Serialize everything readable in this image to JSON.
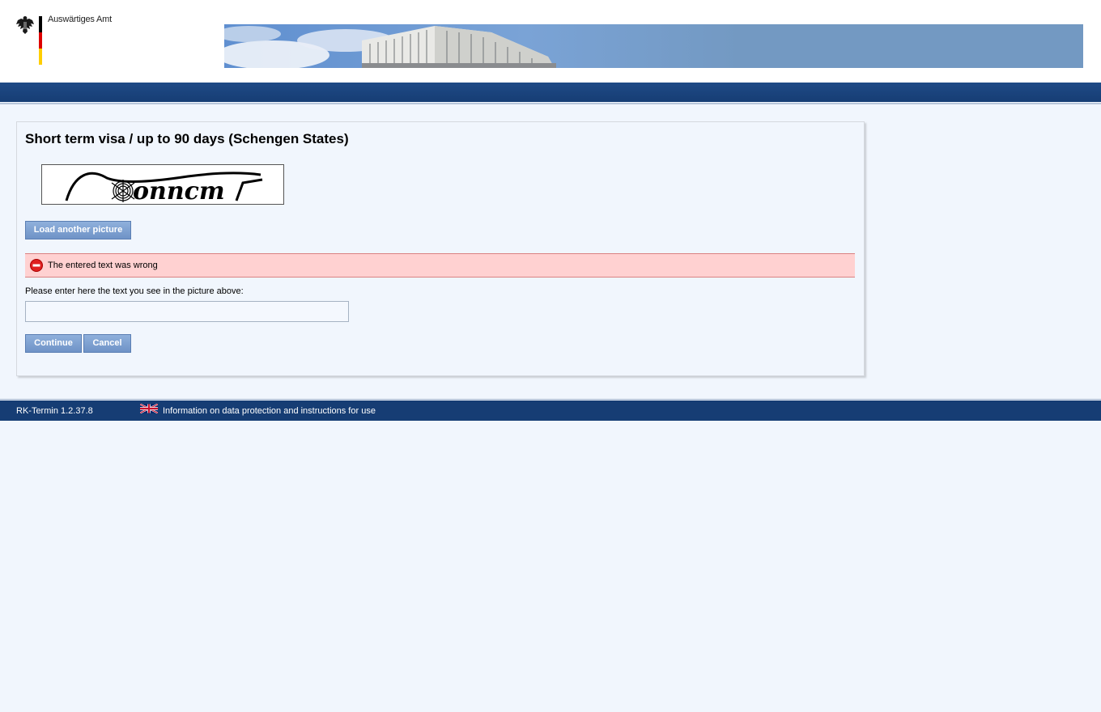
{
  "header": {
    "org_name": "Auswärtiges Amt",
    "colors": {
      "flag_black": "#000000",
      "flag_red": "#dd0000",
      "flag_gold": "#ffce00"
    }
  },
  "form": {
    "title": "Short term visa / up to 90 days (Schengen States)",
    "captcha_text": "onncm",
    "load_another_label": "Load another picture",
    "error_message": "The entered text was wrong",
    "input_label": "Please enter here the text you see in the picture above:",
    "input_value": "",
    "continue_label": "Continue",
    "cancel_label": "Cancel"
  },
  "footer": {
    "version": "RK-Termin 1.2.37.8",
    "info_link": "Information on data protection and instructions for use"
  }
}
